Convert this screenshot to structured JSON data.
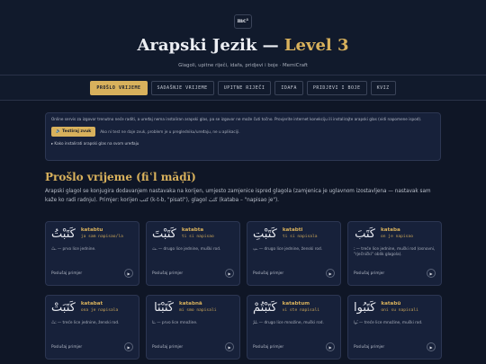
{
  "header": {
    "logo": "mc¹",
    "title_main": "Arapski Jezik — ",
    "title_level": "Level 3",
    "subtitle": "Glagoli, upitne riječi, idafa, pridjevi i boje · MemiCraft"
  },
  "tabs": [
    {
      "label": "PROŠLO VRIJEME",
      "active": true
    },
    {
      "label": "SADAŠNJE VRIJEME",
      "active": false
    },
    {
      "label": "UPITNE RIJEČI",
      "active": false
    },
    {
      "label": "IDAFA",
      "active": false
    },
    {
      "label": "PRIDJEVI I BOJE",
      "active": false
    },
    {
      "label": "KVIZ",
      "active": false
    }
  ],
  "notice": {
    "text": "Online servis za izgovor trenutno neće raditi, a uređaj nema instaliran arapski glas, pa se izgovor ne može čuti točno. Provjerite internet konekciju ili instalirajte arapski glas (vidi napomene ispod).",
    "test_button": "Testiraj zvuk",
    "hint": "Ako ni test ne daje zvuk, problem je u pregledniku/uređaju, ne u aplikaciji.",
    "install_link": "▸ Kako instalirati arapski glas na svom uređaju"
  },
  "section": {
    "title": "Prošlo vrijeme (fiʿl māḍī)",
    "intro": "Arapski glagol se konjugira dodavanjem nastavaka na korijen, umjesto zamjenice ispred glagola (zamjenica je uglavnom izostavljena — nastavak sam kaže ko radi radnju). Primjer: korijen كتب (k-t-b, \"pisati\"), glagol كَتَبَ (kataba – \"napisao je\")."
  },
  "listen_label": "Poslušaj primjer",
  "cards": [
    {
      "arabic": "كَتَبْتُ",
      "translit": "katabtu",
      "gloss": "ja sam napisao/la",
      "desc": "ـتُ — prvo lice jednine."
    },
    {
      "arabic": "كَتَبْتَ",
      "translit": "katabta",
      "gloss": "ti si napisao",
      "desc": "ـتَ — drugo lice jednine, muški rod."
    },
    {
      "arabic": "كَتَبْتِ",
      "translit": "katabti",
      "gloss": "ti si napisala",
      "desc": "ـتِ — drugo lice jednine, ženski rod."
    },
    {
      "arabic": "كَتَبَ",
      "translit": "kataba",
      "gloss": "on je napisao",
      "desc": "ـَ — treće lice jednine, muški rod (osnovni, \"rječnički\" oblik glagola)."
    },
    {
      "arabic": "كَتَبَتْ",
      "translit": "katabat",
      "gloss": "ona je napisala",
      "desc": "ـَتْ — treće lice jednine, ženski rod."
    },
    {
      "arabic": "كَتَبْنَا",
      "translit": "katabnā",
      "gloss": "mi smo napisali",
      "desc": "ـنَا — prvo lice množine."
    },
    {
      "arabic": "كَتَبْتُمْ",
      "translit": "katabtum",
      "gloss": "vi ste napisali",
      "desc": "ـتُمْ — drugo lice množine, muški rod."
    },
    {
      "arabic": "كَتَبُوا",
      "translit": "katabū",
      "gloss": "oni su napisali",
      "desc": "ـُوا — treće lice množine, muški rod."
    }
  ]
}
